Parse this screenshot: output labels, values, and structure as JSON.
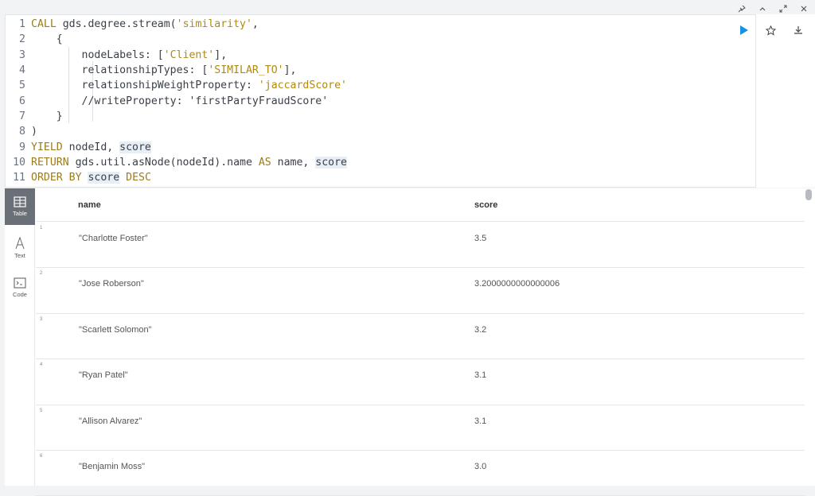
{
  "window": {
    "controls": [
      "pin-icon",
      "collapse-icon",
      "fullscreen-icon",
      "close-icon"
    ]
  },
  "editor": {
    "lines": [
      {
        "n": "1",
        "parts": [
          {
            "t": "CALL",
            "c": "kw"
          },
          {
            "t": " gds.degree.stream(",
            "c": ""
          },
          {
            "t": "'similarity'",
            "c": "str"
          },
          {
            "t": ",",
            "c": ""
          }
        ]
      },
      {
        "n": "2",
        "parts": [
          {
            "t": "    {",
            "c": ""
          }
        ]
      },
      {
        "n": "3",
        "parts": [
          {
            "t": "        nodeLabels: [",
            "c": ""
          },
          {
            "t": "'Client'",
            "c": "str"
          },
          {
            "t": "],",
            "c": ""
          }
        ]
      },
      {
        "n": "4",
        "parts": [
          {
            "t": "        relationshipTypes: [",
            "c": ""
          },
          {
            "t": "'SIMILAR_TO'",
            "c": "str"
          },
          {
            "t": "],",
            "c": ""
          }
        ]
      },
      {
        "n": "5",
        "parts": [
          {
            "t": "        relationshipWeightProperty: ",
            "c": ""
          },
          {
            "t": "'jaccardScore'",
            "c": "str"
          }
        ]
      },
      {
        "n": "6",
        "parts": [
          {
            "t": "        //writeProperty: 'firstPartyFraudScore'",
            "c": ""
          }
        ]
      },
      {
        "n": "7",
        "parts": [
          {
            "t": "    }",
            "c": ""
          }
        ]
      },
      {
        "n": "8",
        "parts": [
          {
            "t": ")",
            "c": ""
          }
        ]
      },
      {
        "n": "9",
        "parts": [
          {
            "t": "YIELD",
            "c": "kw"
          },
          {
            "t": " nodeId, ",
            "c": ""
          },
          {
            "t": "score",
            "c": "hl"
          }
        ]
      },
      {
        "n": "10",
        "parts": [
          {
            "t": "RETURN",
            "c": "kw"
          },
          {
            "t": " gds.util.asNode(nodeId).name ",
            "c": ""
          },
          {
            "t": "AS",
            "c": "kw"
          },
          {
            "t": " name, ",
            "c": ""
          },
          {
            "t": "score",
            "c": "hl"
          }
        ]
      },
      {
        "n": "11",
        "parts": [
          {
            "t": "ORDER BY",
            "c": "kw"
          },
          {
            "t": " ",
            "c": ""
          },
          {
            "t": "score",
            "c": "hl"
          },
          {
            "t": " ",
            "c": ""
          },
          {
            "t": "DESC",
            "c": "kw"
          }
        ]
      }
    ]
  },
  "actions": {
    "run": "play-icon",
    "favorite": "star-icon",
    "download": "download-icon"
  },
  "colors": {
    "run": "#1a8fe3",
    "active_nav": "#6b7078",
    "keyword": "#9b7b1b",
    "string": "#b08a12"
  },
  "nav": [
    {
      "label": "Table",
      "icon": "table-icon"
    },
    {
      "label": "Text",
      "icon": "text-icon"
    },
    {
      "label": "Code",
      "icon": "code-icon"
    }
  ],
  "table": {
    "headers": [
      "name",
      "score"
    ],
    "rows": [
      {
        "i": "1",
        "name": "\"Charlotte Foster\"",
        "score": "3.5"
      },
      {
        "i": "2",
        "name": "\"Jose Roberson\"",
        "score": "3.2000000000000006"
      },
      {
        "i": "3",
        "name": "\"Scarlett Solomon\"",
        "score": "3.2"
      },
      {
        "i": "4",
        "name": "\"Ryan Patel\"",
        "score": "3.1"
      },
      {
        "i": "5",
        "name": "\"Allison Alvarez\"",
        "score": "3.1"
      },
      {
        "i": "6",
        "name": "\"Benjamin Moss\"",
        "score": "3.0"
      }
    ]
  }
}
